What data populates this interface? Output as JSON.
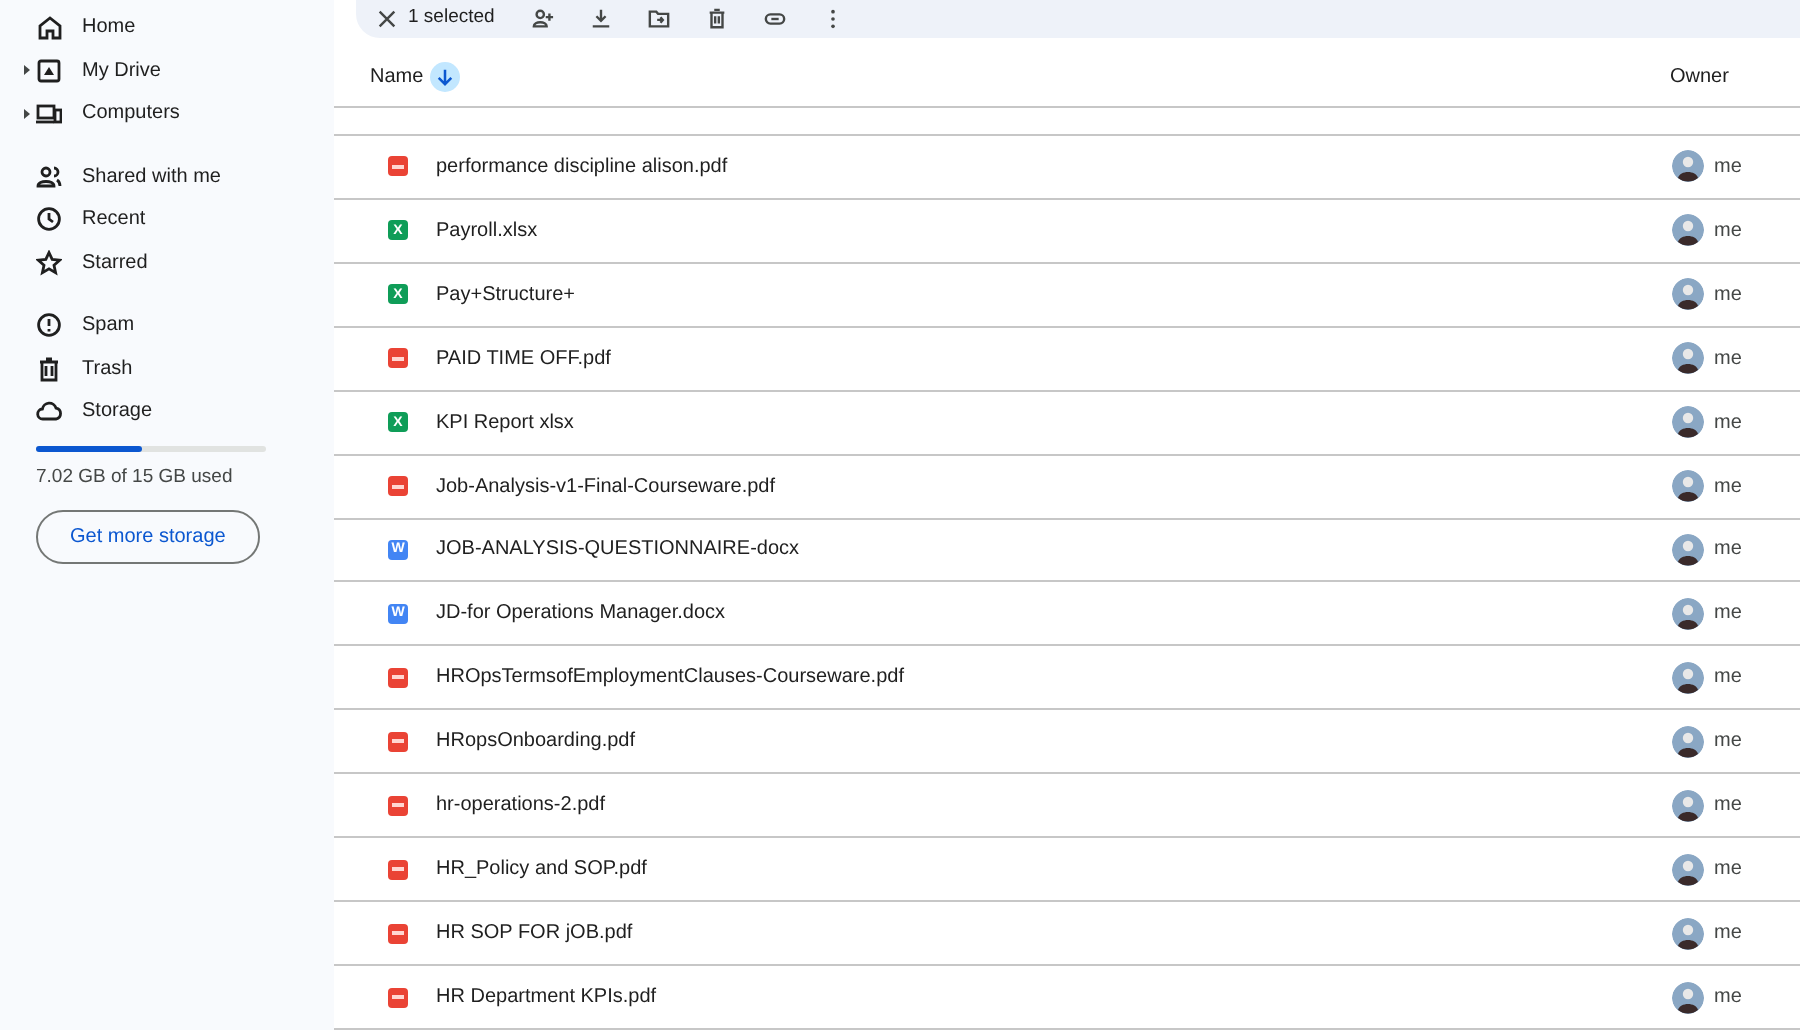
{
  "sidebar": {
    "groups": [
      {
        "items": [
          {
            "label": "Home",
            "expandable": false
          },
          {
            "label": "My Drive",
            "expandable": true
          },
          {
            "label": "Computers",
            "expandable": true
          }
        ]
      },
      {
        "items": [
          {
            "label": "Shared with me",
            "expandable": false
          },
          {
            "label": "Recent",
            "expandable": false
          },
          {
            "label": "Starred",
            "expandable": false
          }
        ]
      },
      {
        "items": [
          {
            "label": "Spam",
            "expandable": false
          },
          {
            "label": "Trash",
            "expandable": false
          },
          {
            "label": "Storage",
            "expandable": false
          }
        ]
      }
    ],
    "storage": {
      "level": 0.46,
      "text": "7.02 GB of 15 GB used"
    },
    "button": "Get more storage"
  },
  "toolbar": {
    "selection": "1 selected"
  },
  "table": {
    "columns": [
      {
        "label": "Name",
        "sorted": true
      },
      {
        "label": "Owner",
        "sorted": false
      }
    ],
    "rows": [
      {
        "kind": "pdf",
        "name": "performance discipline alison.pdf",
        "owner": "me"
      },
      {
        "kind": "sheet",
        "letter": "X",
        "name": "Payroll.xlsx",
        "owner": "me"
      },
      {
        "kind": "sheet",
        "letter": "X",
        "name": "Pay+Structure+",
        "owner": "me"
      },
      {
        "kind": "pdf",
        "name": "PAID TIME OFF.pdf",
        "owner": "me"
      },
      {
        "kind": "sheet",
        "letter": "X",
        "name": "KPI Report xlsx",
        "owner": "me"
      },
      {
        "kind": "pdf",
        "name": "Job-Analysis-v1-Final-Courseware.pdf",
        "owner": "me"
      },
      {
        "kind": "doc",
        "letter": "W",
        "name": "JOB-ANALYSIS-QUESTIONNAIRE-docx",
        "owner": "me"
      },
      {
        "kind": "doc",
        "letter": "W",
        "name": "JD-for Operations Manager.docx",
        "owner": "me"
      },
      {
        "kind": "pdf",
        "name": "HROpsTermsofEmploymentClauses-Courseware.pdf",
        "owner": "me"
      },
      {
        "kind": "pdf",
        "name": "HRopsOnboarding.pdf",
        "owner": "me"
      },
      {
        "kind": "pdf",
        "name": "hr-operations-2.pdf",
        "owner": "me"
      },
      {
        "kind": "pdf",
        "name": "HR_Policy and SOP.pdf",
        "owner": "me"
      },
      {
        "kind": "pdf",
        "name": "HR SOP FOR jOB.pdf",
        "owner": "me"
      },
      {
        "kind": "pdf",
        "name": "HR Department KPIs.pdf",
        "owner": "me"
      }
    ]
  }
}
